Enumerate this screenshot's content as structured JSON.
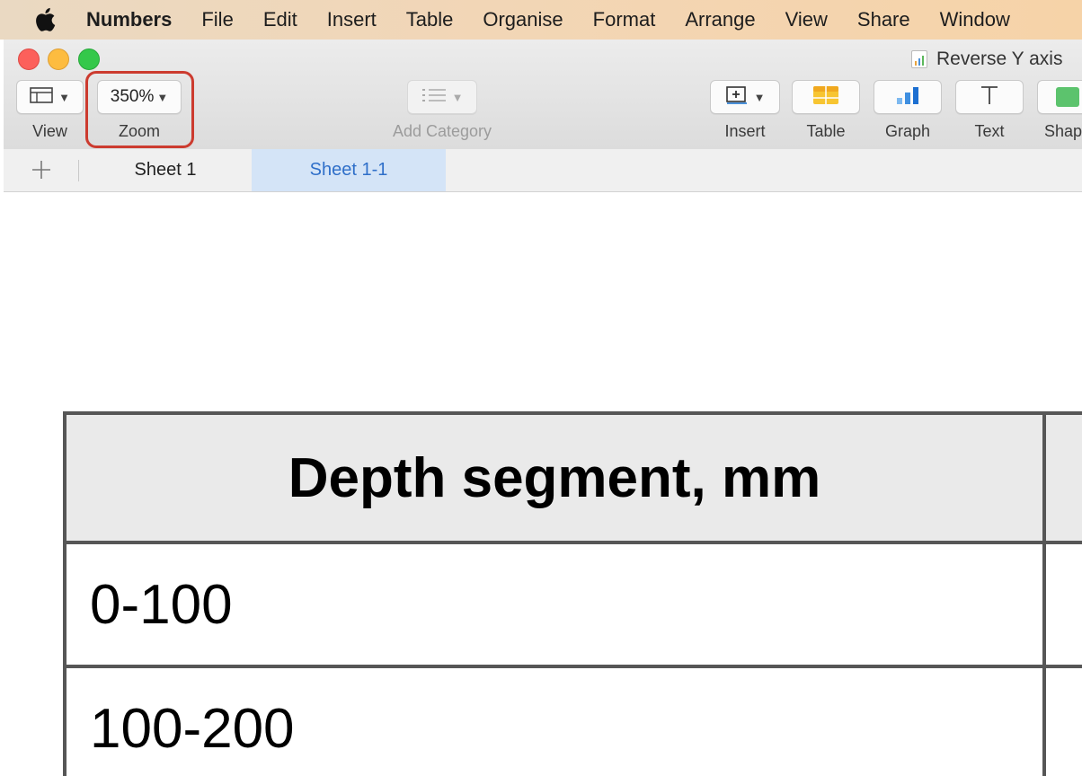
{
  "menubar": {
    "app_name": "Numbers",
    "items": [
      "File",
      "Edit",
      "Insert",
      "Table",
      "Organise",
      "Format",
      "Arrange",
      "View",
      "Share",
      "Window"
    ]
  },
  "window": {
    "document_title": "Reverse Y axis"
  },
  "toolbar": {
    "view_label": "View",
    "zoom_value": "350%",
    "zoom_label": "Zoom",
    "add_category_label": "Add Category",
    "insert_label": "Insert",
    "table_label": "Table",
    "graph_label": "Graph",
    "text_label": "Text",
    "shape_label": "Shape"
  },
  "sheets": {
    "tabs": [
      {
        "label": "Sheet 1",
        "active": false
      },
      {
        "label": "Sheet 1-1",
        "active": true
      }
    ]
  },
  "table": {
    "header": "Depth segment, mm",
    "rows": [
      "0-100",
      "100-200"
    ]
  },
  "colors": {
    "highlight": "#cc3b2f",
    "active_tab_bg": "#d4e4f7",
    "active_tab_text": "#2f6fc9"
  }
}
